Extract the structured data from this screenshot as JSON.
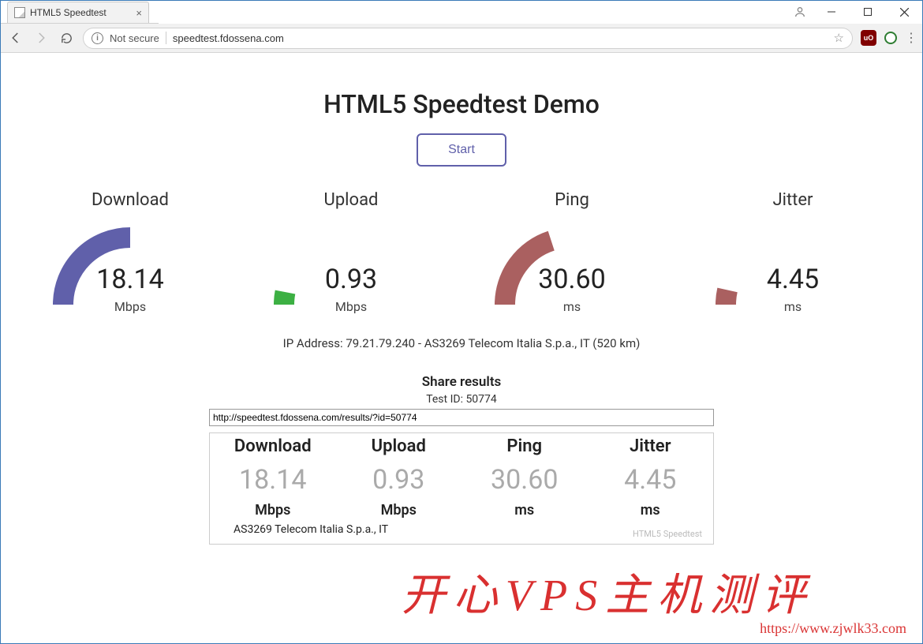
{
  "window": {
    "tab_title": "HTML5 Speedtest",
    "not_secure": "Not secure",
    "url": "speedtest.fdossena.com"
  },
  "colors": {
    "purple": "#6060AA",
    "green": "#33aa33",
    "brown": "#aa6060",
    "brown2": "#aa6060",
    "ublock": "#800000",
    "green_ext": "#2e7d32"
  },
  "page": {
    "title": "HTML5 Speedtest Demo",
    "start_label": "Start",
    "gauges": [
      {
        "label": "Download",
        "value": "18.14",
        "unit": "Mbps",
        "color": "#6060AA",
        "frac": 0.5
      },
      {
        "label": "Upload",
        "value": "0.93",
        "unit": "Mbps",
        "color": "#3cb043",
        "frac": 0.06
      },
      {
        "label": "Ping",
        "value": "30.60",
        "unit": "ms",
        "color": "#aa6060",
        "frac": 0.4
      },
      {
        "label": "Jitter",
        "value": "4.45",
        "unit": "ms",
        "color": "#aa6060",
        "frac": 0.07
      }
    ],
    "ip_line": "IP Address: 79.21.79.240 - AS3269 Telecom Italia S.p.a., IT (520 km)",
    "share": {
      "title": "Share results",
      "test_id": "Test ID: 50774",
      "url": "http://speedtest.fdossena.com/results/?id=50774"
    },
    "result_card": {
      "cols": [
        {
          "h": "Download",
          "v": "18.14",
          "u": "Mbps"
        },
        {
          "h": "Upload",
          "v": "0.93",
          "u": "Mbps"
        },
        {
          "h": "Ping",
          "v": "30.60",
          "u": "ms"
        },
        {
          "h": "Jitter",
          "v": "4.45",
          "u": "ms"
        }
      ],
      "isp": "AS3269 Telecom Italia S.p.a., IT",
      "brand": "HTML5 Speedtest"
    }
  },
  "watermark": {
    "cn": "开心VPS主机测评",
    "url": "https://www.zjwlk33.com"
  }
}
